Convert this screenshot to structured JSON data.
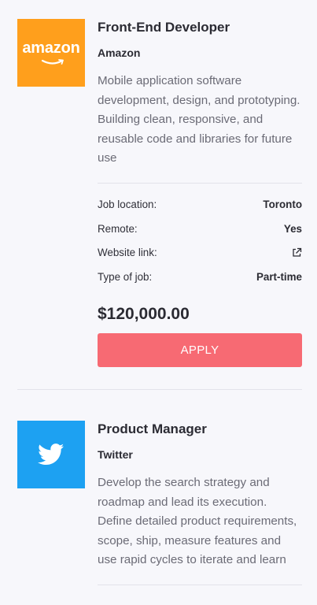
{
  "jobs": [
    {
      "title": "Front-End Developer",
      "company": "Amazon",
      "logo_text": "amazon",
      "logo_color": "#ff9f1c",
      "description": "Mobile application software development, design, and prototyping. Building clean, responsive, and reusable code and libraries for future use",
      "details": [
        {
          "label": "Job location:",
          "value": "Toronto"
        },
        {
          "label": "Remote:",
          "value": "Yes"
        },
        {
          "label": "Website link:",
          "value": "external-link-icon"
        },
        {
          "label": "Type of job:",
          "value": "Part-time"
        }
      ],
      "salary": "$120,000.00",
      "apply_label": "APPLY"
    },
    {
      "title": "Product Manager",
      "company": "Twitter",
      "logo_icon": "twitter-bird-icon",
      "logo_color": "#1da1f2",
      "description": "Develop the search strategy and roadmap and lead its execution. Define detailed product requirements, scope, ship, measure features and use rapid cycles to iterate and learn"
    }
  ],
  "colors": {
    "accent": "#f76a73",
    "background": "#f7f7fb"
  }
}
